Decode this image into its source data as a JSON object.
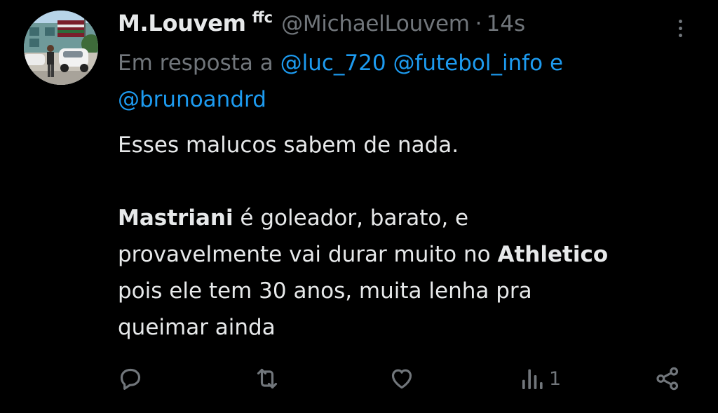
{
  "author": {
    "display_name": "M.Louvem",
    "name_tag": "ffc",
    "handle": "@MichaelLouvem",
    "separator": "·",
    "time": "14s"
  },
  "reply_to": {
    "prefix": "Em resposta a",
    "mentions": [
      "@luc_720",
      "@futebol_info",
      "@brunoandrd"
    ],
    "conjunction": "e"
  },
  "body": {
    "line1": "Esses malucos sabem de nada.",
    "player": "Mastriani",
    "line2_rest": " é goleador, barato, e",
    "line3_pre": "provavelmente vai durar muito no ",
    "club": "Athletico",
    "line4": "pois ele tem 30 anos, muita lenha pra",
    "line5": "queimar ainda"
  },
  "actions": {
    "reply_icon": "reply-icon",
    "retweet_icon": "retweet-icon",
    "like_icon": "heart-icon",
    "views_icon": "views-chart-icon",
    "views_count": "1",
    "share_icon": "share-icon"
  },
  "colors": {
    "background": "#000000",
    "text": "#e7e9ea",
    "muted": "#71767b",
    "link": "#1d9bf0"
  }
}
